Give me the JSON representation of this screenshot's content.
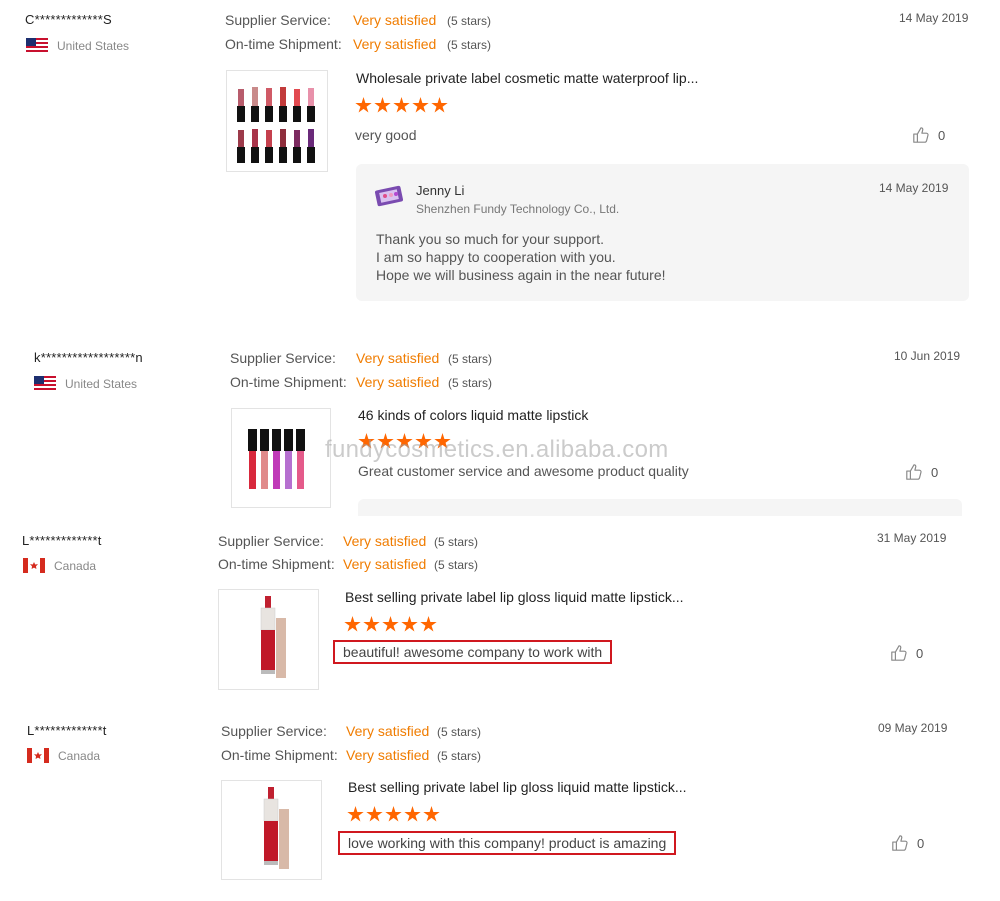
{
  "labels": {
    "supplier_service": "Supplier Service:",
    "ontime_shipment": "On-time Shipment:"
  },
  "watermark": "fundycosmetics.en.alibaba.com",
  "colors": {
    "accent": "#f07c00",
    "star": "#ff6600",
    "highlight_box": "#d0181f"
  },
  "reviews": [
    {
      "buyer": "C*************S",
      "country": "United States",
      "flag": "us-flag-icon",
      "supplier_service": {
        "value": "Very satisfied",
        "stars": "(5 stars)"
      },
      "ontime_shipment": {
        "value": "Very satisfied",
        "stars": "(5 stars)"
      },
      "date": "14 May 2019",
      "product_title": "Wholesale private label cosmetic matte waterproof lip...",
      "rating": 5,
      "comment": "very good",
      "likes": "0",
      "reply": {
        "name": "Jenny Li",
        "company": "Shenzhen Fundy Technology Co., Ltd.",
        "date": "14 May 2019",
        "lines": [
          "Thank you so much for your support.",
          "I am so happy to cooperation with you.",
          "Hope we will business again in the near future!"
        ]
      }
    },
    {
      "buyer": "k******************n",
      "country": "United States",
      "flag": "us-flag-icon",
      "supplier_service": {
        "value": "Very satisfied",
        "stars": "(5 stars)"
      },
      "ontime_shipment": {
        "value": "Very satisfied",
        "stars": "(5 stars)"
      },
      "date": "10 Jun 2019",
      "product_title": "46 kinds of colors liquid matte lipstick",
      "rating": 5,
      "comment": "Great customer service and awesome product quality",
      "likes": "0"
    },
    {
      "buyer": "L*************t",
      "country": "Canada",
      "flag": "canada-flag-icon",
      "supplier_service": {
        "value": "Very satisfied",
        "stars": "(5 stars)"
      },
      "ontime_shipment": {
        "value": "Very satisfied",
        "stars": "(5 stars)"
      },
      "date": "31 May 2019",
      "product_title": "Best selling private label lip gloss liquid matte lipstick...",
      "rating": 5,
      "comment": "beautiful! awesome company to work with",
      "likes": "0"
    },
    {
      "buyer": "L*************t",
      "country": "Canada",
      "flag": "canada-flag-icon",
      "supplier_service": {
        "value": "Very satisfied",
        "stars": "(5 stars)"
      },
      "ontime_shipment": {
        "value": "Very satisfied",
        "stars": "(5 stars)"
      },
      "date": "09 May 2019",
      "product_title": "Best selling private label lip gloss liquid matte lipstick...",
      "rating": 5,
      "comment": "love working with this company! product is amazing",
      "likes": "0"
    }
  ]
}
